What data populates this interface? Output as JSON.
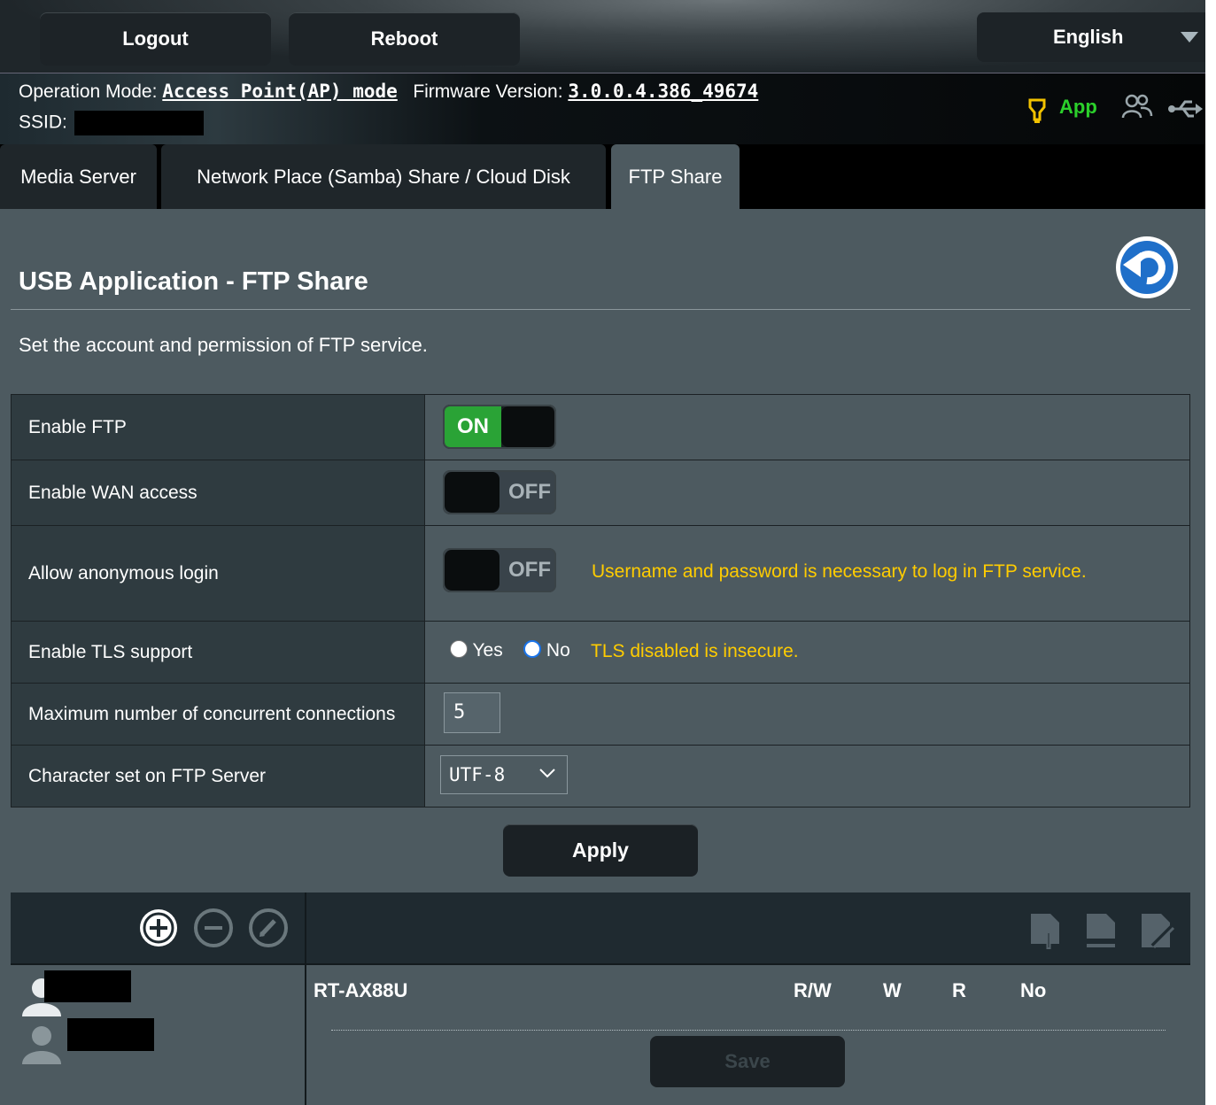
{
  "header": {
    "logout_label": "Logout",
    "reboot_label": "Reboot",
    "language": "English",
    "operation_mode_label": "Operation Mode:",
    "operation_mode_value": "Access Point(AP) mode",
    "firmware_label": "Firmware Version:",
    "firmware_value": "3.0.0.4.386_49674",
    "ssid_label": "SSID:",
    "app_label": "App"
  },
  "tabs": [
    {
      "label": "Media Server"
    },
    {
      "label": "Network Place (Samba) Share / Cloud Disk"
    },
    {
      "label": "FTP Share",
      "active": true
    }
  ],
  "page": {
    "title": "USB Application - FTP Share",
    "description": "Set the account and permission of FTP service."
  },
  "settings": {
    "enable_ftp": {
      "label": "Enable FTP",
      "state": "ON"
    },
    "enable_wan": {
      "label": "Enable WAN access",
      "state": "OFF"
    },
    "anonymous": {
      "label": "Allow anonymous login",
      "state": "OFF",
      "note": "Username and password is necessary to log in FTP service."
    },
    "tls": {
      "label": "Enable TLS support",
      "yes": "Yes",
      "no": "No",
      "selected": "No",
      "note": "TLS disabled is insecure."
    },
    "max_conn": {
      "label": "Maximum number of concurrent connections",
      "value": "5"
    },
    "charset": {
      "label": "Character set on FTP Server",
      "value": "UTF-8"
    }
  },
  "apply_label": "Apply",
  "accounts": {
    "device": "RT-AX88U",
    "permissions": [
      "R/W",
      "W",
      "R",
      "No"
    ],
    "save_label": "Save"
  },
  "colors": {
    "toggle_on": "#2aa336",
    "warning": "#ffcc00",
    "app": "#2bd02b"
  }
}
